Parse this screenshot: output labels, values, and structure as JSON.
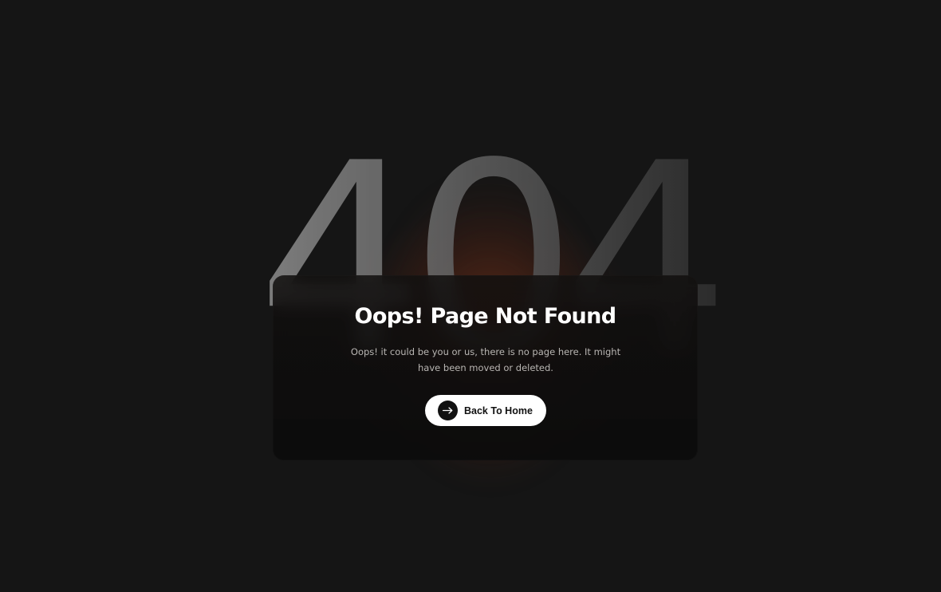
{
  "hero": {
    "code": "404"
  },
  "card": {
    "title": "Oops! Page Not Found",
    "description": "Oops! it could be you or us, there is no page here. It might have been moved or deleted.",
    "button_label": "Back To Home",
    "button_icon": "arrow-right-icon"
  },
  "colors": {
    "background": "#151515",
    "glow": "#6e301a",
    "button_bg": "#ffffff",
    "button_text": "#111111",
    "title": "#ffffff",
    "description": "#b9b6b3"
  }
}
